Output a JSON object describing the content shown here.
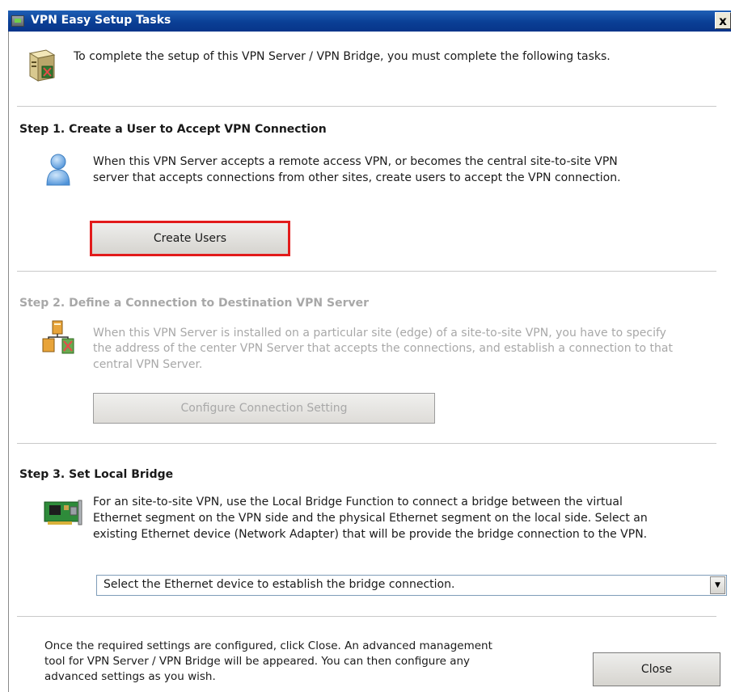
{
  "window": {
    "title": "VPN Easy Setup Tasks",
    "close_glyph": "x"
  },
  "intro": {
    "text": "To complete the setup of this VPN Server / VPN Bridge, you must complete the following tasks.",
    "icon": "server-computer-icon"
  },
  "step1": {
    "heading": "Step 1. Create a User to Accept VPN Connection",
    "line1": "When this VPN Server accepts a remote access VPN, or becomes the central site-to-site VPN",
    "line2": "server that accepts connections from other sites, create users to accept the VPN connection.",
    "button": "Create Users",
    "icon": "user-icon"
  },
  "step2": {
    "heading": "Step 2. Define a Connection to Destination VPN Server",
    "line1": "When this VPN Server is installed on a particular site (edge) of a site-to-site VPN, you have to specify",
    "line2": "the address of the center VPN Server that accepts the connections, and establish a connection to that",
    "line3": "central VPN Server.",
    "button": "Configure Connection Setting",
    "icon": "network-connection-icon",
    "enabled": false
  },
  "step3": {
    "heading": "Step 3. Set Local Bridge",
    "line1": "For an site-to-site VPN, use the Local Bridge Function to connect a bridge between the virtual",
    "line2": "Ethernet segment on the VPN side and the physical Ethernet segment on the local side. Select an",
    "line3": "existing Ethernet device (Network Adapter) that will be provide the bridge connection to the VPN.",
    "select_value": "Select the Ethernet device to establish the bridge connection.",
    "icon": "network-adapter-icon"
  },
  "footer": {
    "line1": "Once the required settings are configured, click Close. An advanced management",
    "line2": "tool for VPN Server / VPN Bridge will be appeared. You can then configure any",
    "line3": "advanced settings as you wish.",
    "close_button": "Close"
  },
  "colors": {
    "titlebar": "#0a3f95",
    "highlight_border": "#e21b1b",
    "disabled_text": "#a8a8a8"
  }
}
